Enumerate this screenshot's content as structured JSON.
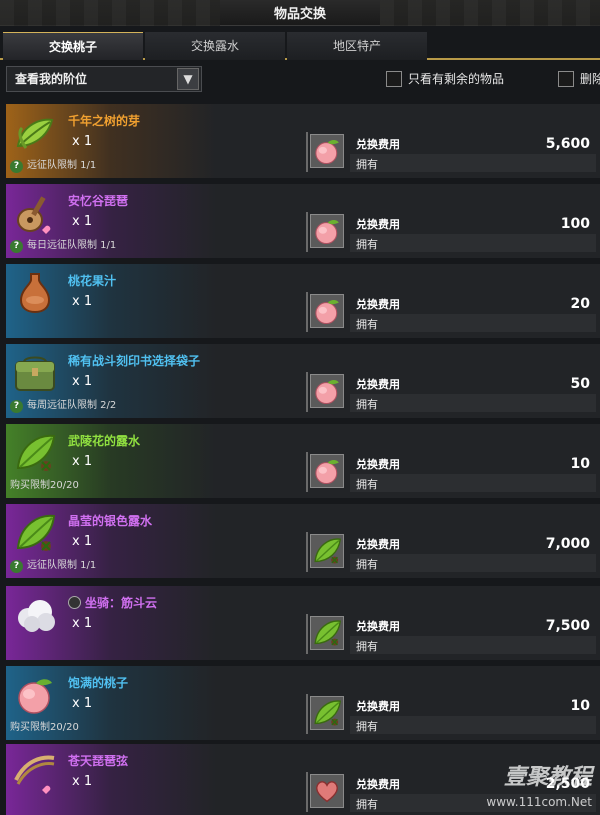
{
  "window": {
    "title": "物品交换"
  },
  "tabs": [
    {
      "label": "交换桃子",
      "active": true
    },
    {
      "label": "交换露水",
      "active": false
    },
    {
      "label": "地区特产",
      "active": false
    }
  ],
  "filter": {
    "rank_select": "查看我的阶位",
    "only_remaining": "只看有剩余的物品",
    "truncated_option": "删除"
  },
  "labels": {
    "cost": "兑换费用",
    "own": "拥有"
  },
  "items": [
    {
      "name": "千年之树的芽",
      "qty": "x 1",
      "limit": "远征队限制 1/1",
      "limit_help": true,
      "cost": "5,600",
      "rarity": "orange",
      "icon": "sprout-icon",
      "cost_icon": "peach-icon"
    },
    {
      "name": "安忆谷琵琶",
      "qty": "x 1",
      "limit": "每日远征队限制 1/1",
      "limit_help": true,
      "cost": "100",
      "rarity": "purple",
      "icon": "lute-icon",
      "cost_icon": "peach-icon"
    },
    {
      "name": "桃花果汁",
      "qty": "x 1",
      "limit": "",
      "limit_help": false,
      "cost": "20",
      "rarity": "blue",
      "icon": "vase-icon",
      "cost_icon": "peach-icon"
    },
    {
      "name": "稀有战斗刻印书选择袋子",
      "qty": "x 1",
      "limit": "每周远征队限制 2/2",
      "limit_help": true,
      "cost": "50",
      "rarity": "blue",
      "icon": "bag-icon",
      "cost_icon": "peach-icon"
    },
    {
      "name": "武陵花的露水",
      "qty": "x 1",
      "limit": "购买限制20/20",
      "limit_help": false,
      "cost": "10",
      "rarity": "green",
      "icon": "dew-leaf-icon",
      "cost_icon": "peach-icon"
    },
    {
      "name": "晶莹的银色露水",
      "qty": "x 1",
      "limit": "远征队限制 1/1",
      "limit_help": true,
      "cost": "7,000",
      "rarity": "purple",
      "icon": "dew-leaf-icon",
      "cost_icon": "dew-leaf-icon"
    },
    {
      "name": "坐骑：筋斗云",
      "qty": "x 1",
      "limit": "",
      "limit_help": false,
      "cost": "7,500",
      "rarity": "purple",
      "icon": "cloud-icon",
      "cost_icon": "dew-leaf-icon",
      "magnifier": true
    },
    {
      "name": "饱满的桃子",
      "qty": "x 1",
      "limit": "购买限制20/20",
      "limit_help": false,
      "cost": "10",
      "rarity": "blue",
      "icon": "peach-icon",
      "cost_icon": "dew-leaf-icon"
    },
    {
      "name": "苍天琵琶弦",
      "qty": "x 1",
      "limit": "",
      "limit_help": false,
      "cost": "2,500",
      "rarity": "purple",
      "icon": "strings-icon",
      "cost_icon": "heart-icon"
    }
  ],
  "watermark": {
    "title": "壹聚教程",
    "url": "www.111com.Net"
  }
}
